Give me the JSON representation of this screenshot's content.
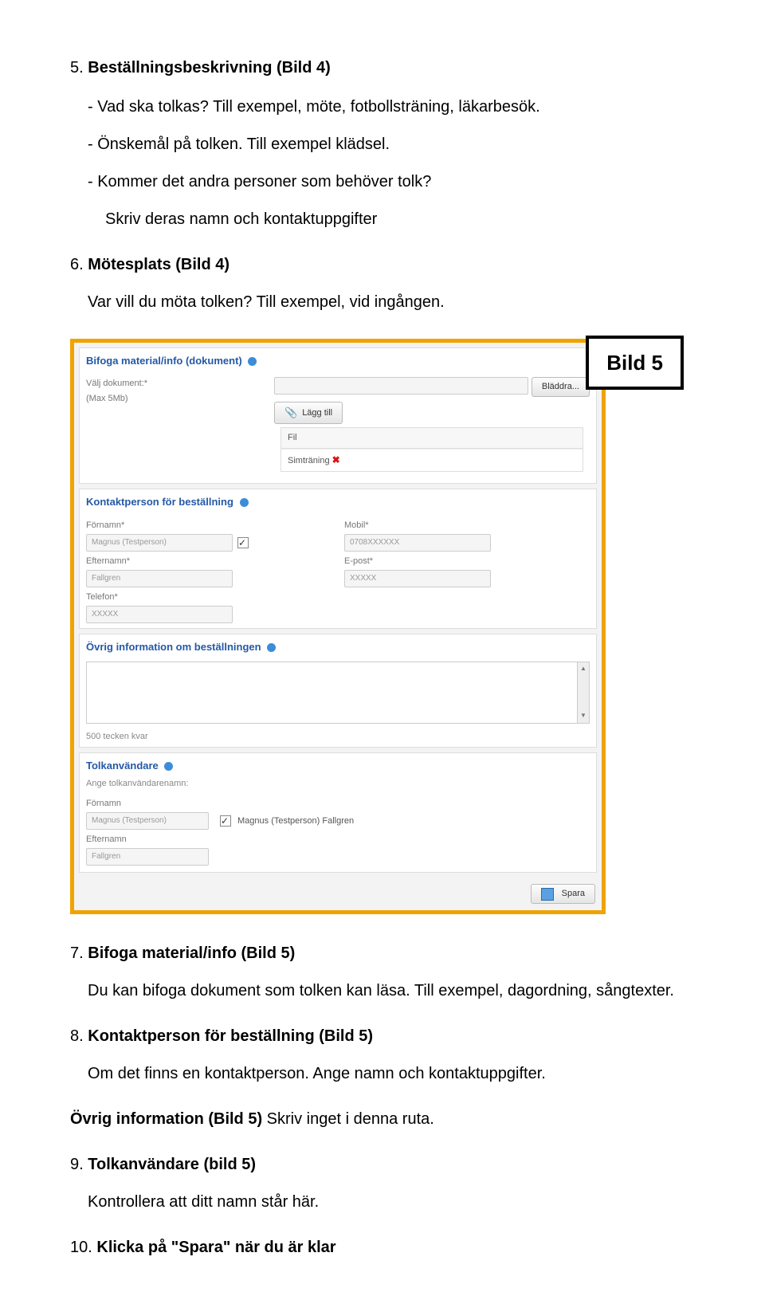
{
  "items": {
    "i5": {
      "num": "5.",
      "title": "Beställningsbeskrivning (Bild 4)",
      "subs": [
        "-   Vad ska tolkas? Till exempel, möte, fotbollsträning, läkarbesök.",
        "-   Önskemål på tolken. Till exempel klädsel.",
        "-   Kommer det andra personer som behöver tolk?"
      ],
      "tail": "Skriv deras namn och kontaktuppgifter"
    },
    "i6": {
      "num": "6.",
      "title": "Mötesplats (Bild 4)",
      "line": "Var vill du möta tolken? Till exempel, vid ingången."
    },
    "i7": {
      "num": "7.",
      "title": "Bifoga material/info (Bild 5)",
      "line": "Du kan bifoga dokument som tolken kan läsa. Till exempel, dagordning, sångtexter."
    },
    "i8": {
      "num": "8.",
      "title": "Kontaktperson för beställning (Bild 5)",
      "line": "Om det finns en kontaktperson. Ange namn och kontaktuppgifter."
    },
    "ovrig": "Övrig information (Bild 5) Skriv inget i denna ruta.",
    "ovrig_bold": "Övrig information (Bild 5)",
    "ovrig_rest": " Skriv inget i denna ruta.",
    "i9": {
      "num": "9.",
      "title": "Tolkanvändare (bild 5)",
      "line": "Kontrollera att ditt namn står här."
    },
    "i10": {
      "num": "10.",
      "title": "Klicka på \"Spara\" när du är klar"
    }
  },
  "bild5": "Bild 5",
  "form": {
    "attach": {
      "header": "Bifoga material/info (dokument)",
      "choose_label": "Välj dokument:*",
      "max": "(Max 5Mb)",
      "browse": "Bläddra...",
      "add": "Lägg till",
      "col_fil": "Fil",
      "file_row": "Simträning"
    },
    "contact": {
      "header": "Kontaktperson för beställning",
      "fornamn": "Förnamn*",
      "fornamn_val": "Magnus (Testperson)",
      "efternamn": "Efternamn*",
      "efternamn_val": "Fallgren",
      "telefon": "Telefon*",
      "telefon_val": "XXXXX",
      "mobil": "Mobil*",
      "mobil_val": "0708XXXXXX",
      "epost": "E-post*",
      "epost_val": "XXXXX"
    },
    "ovrig": {
      "header": "Övrig information om beställningen",
      "counter": "500 tecken kvar"
    },
    "user": {
      "header": "Tolkanvändare",
      "sub": "Ange tolkanvändarenamn:",
      "fornamn": "Förnamn",
      "fornamn_val": "Magnus (Testperson)",
      "fullname": "Magnus (Testperson) Fallgren",
      "efternamn": "Efternamn",
      "efternamn_val": "Fallgren"
    },
    "save": "Spara"
  }
}
